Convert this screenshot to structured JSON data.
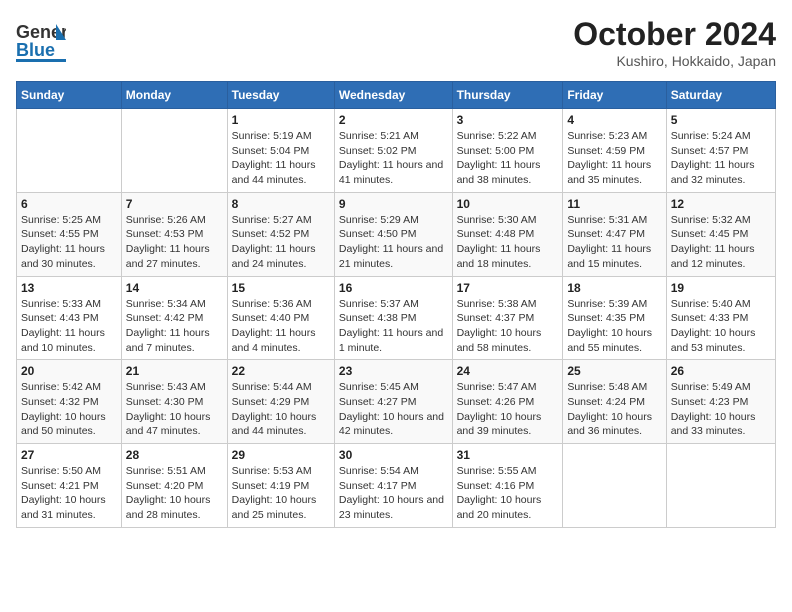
{
  "header": {
    "logo_line1": "General",
    "logo_line2": "Blue",
    "title": "October 2024",
    "subtitle": "Kushiro, Hokkaido, Japan"
  },
  "weekdays": [
    "Sunday",
    "Monday",
    "Tuesday",
    "Wednesday",
    "Thursday",
    "Friday",
    "Saturday"
  ],
  "weeks": [
    [
      {
        "day": "",
        "sunrise": "",
        "sunset": "",
        "daylight": ""
      },
      {
        "day": "",
        "sunrise": "",
        "sunset": "",
        "daylight": ""
      },
      {
        "day": "1",
        "sunrise": "Sunrise: 5:19 AM",
        "sunset": "Sunset: 5:04 PM",
        "daylight": "Daylight: 11 hours and 44 minutes."
      },
      {
        "day": "2",
        "sunrise": "Sunrise: 5:21 AM",
        "sunset": "Sunset: 5:02 PM",
        "daylight": "Daylight: 11 hours and 41 minutes."
      },
      {
        "day": "3",
        "sunrise": "Sunrise: 5:22 AM",
        "sunset": "Sunset: 5:00 PM",
        "daylight": "Daylight: 11 hours and 38 minutes."
      },
      {
        "day": "4",
        "sunrise": "Sunrise: 5:23 AM",
        "sunset": "Sunset: 4:59 PM",
        "daylight": "Daylight: 11 hours and 35 minutes."
      },
      {
        "day": "5",
        "sunrise": "Sunrise: 5:24 AM",
        "sunset": "Sunset: 4:57 PM",
        "daylight": "Daylight: 11 hours and 32 minutes."
      }
    ],
    [
      {
        "day": "6",
        "sunrise": "Sunrise: 5:25 AM",
        "sunset": "Sunset: 4:55 PM",
        "daylight": "Daylight: 11 hours and 30 minutes."
      },
      {
        "day": "7",
        "sunrise": "Sunrise: 5:26 AM",
        "sunset": "Sunset: 4:53 PM",
        "daylight": "Daylight: 11 hours and 27 minutes."
      },
      {
        "day": "8",
        "sunrise": "Sunrise: 5:27 AM",
        "sunset": "Sunset: 4:52 PM",
        "daylight": "Daylight: 11 hours and 24 minutes."
      },
      {
        "day": "9",
        "sunrise": "Sunrise: 5:29 AM",
        "sunset": "Sunset: 4:50 PM",
        "daylight": "Daylight: 11 hours and 21 minutes."
      },
      {
        "day": "10",
        "sunrise": "Sunrise: 5:30 AM",
        "sunset": "Sunset: 4:48 PM",
        "daylight": "Daylight: 11 hours and 18 minutes."
      },
      {
        "day": "11",
        "sunrise": "Sunrise: 5:31 AM",
        "sunset": "Sunset: 4:47 PM",
        "daylight": "Daylight: 11 hours and 15 minutes."
      },
      {
        "day": "12",
        "sunrise": "Sunrise: 5:32 AM",
        "sunset": "Sunset: 4:45 PM",
        "daylight": "Daylight: 11 hours and 12 minutes."
      }
    ],
    [
      {
        "day": "13",
        "sunrise": "Sunrise: 5:33 AM",
        "sunset": "Sunset: 4:43 PM",
        "daylight": "Daylight: 11 hours and 10 minutes."
      },
      {
        "day": "14",
        "sunrise": "Sunrise: 5:34 AM",
        "sunset": "Sunset: 4:42 PM",
        "daylight": "Daylight: 11 hours and 7 minutes."
      },
      {
        "day": "15",
        "sunrise": "Sunrise: 5:36 AM",
        "sunset": "Sunset: 4:40 PM",
        "daylight": "Daylight: 11 hours and 4 minutes."
      },
      {
        "day": "16",
        "sunrise": "Sunrise: 5:37 AM",
        "sunset": "Sunset: 4:38 PM",
        "daylight": "Daylight: 11 hours and 1 minute."
      },
      {
        "day": "17",
        "sunrise": "Sunrise: 5:38 AM",
        "sunset": "Sunset: 4:37 PM",
        "daylight": "Daylight: 10 hours and 58 minutes."
      },
      {
        "day": "18",
        "sunrise": "Sunrise: 5:39 AM",
        "sunset": "Sunset: 4:35 PM",
        "daylight": "Daylight: 10 hours and 55 minutes."
      },
      {
        "day": "19",
        "sunrise": "Sunrise: 5:40 AM",
        "sunset": "Sunset: 4:33 PM",
        "daylight": "Daylight: 10 hours and 53 minutes."
      }
    ],
    [
      {
        "day": "20",
        "sunrise": "Sunrise: 5:42 AM",
        "sunset": "Sunset: 4:32 PM",
        "daylight": "Daylight: 10 hours and 50 minutes."
      },
      {
        "day": "21",
        "sunrise": "Sunrise: 5:43 AM",
        "sunset": "Sunset: 4:30 PM",
        "daylight": "Daylight: 10 hours and 47 minutes."
      },
      {
        "day": "22",
        "sunrise": "Sunrise: 5:44 AM",
        "sunset": "Sunset: 4:29 PM",
        "daylight": "Daylight: 10 hours and 44 minutes."
      },
      {
        "day": "23",
        "sunrise": "Sunrise: 5:45 AM",
        "sunset": "Sunset: 4:27 PM",
        "daylight": "Daylight: 10 hours and 42 minutes."
      },
      {
        "day": "24",
        "sunrise": "Sunrise: 5:47 AM",
        "sunset": "Sunset: 4:26 PM",
        "daylight": "Daylight: 10 hours and 39 minutes."
      },
      {
        "day": "25",
        "sunrise": "Sunrise: 5:48 AM",
        "sunset": "Sunset: 4:24 PM",
        "daylight": "Daylight: 10 hours and 36 minutes."
      },
      {
        "day": "26",
        "sunrise": "Sunrise: 5:49 AM",
        "sunset": "Sunset: 4:23 PM",
        "daylight": "Daylight: 10 hours and 33 minutes."
      }
    ],
    [
      {
        "day": "27",
        "sunrise": "Sunrise: 5:50 AM",
        "sunset": "Sunset: 4:21 PM",
        "daylight": "Daylight: 10 hours and 31 minutes."
      },
      {
        "day": "28",
        "sunrise": "Sunrise: 5:51 AM",
        "sunset": "Sunset: 4:20 PM",
        "daylight": "Daylight: 10 hours and 28 minutes."
      },
      {
        "day": "29",
        "sunrise": "Sunrise: 5:53 AM",
        "sunset": "Sunset: 4:19 PM",
        "daylight": "Daylight: 10 hours and 25 minutes."
      },
      {
        "day": "30",
        "sunrise": "Sunrise: 5:54 AM",
        "sunset": "Sunset: 4:17 PM",
        "daylight": "Daylight: 10 hours and 23 minutes."
      },
      {
        "day": "31",
        "sunrise": "Sunrise: 5:55 AM",
        "sunset": "Sunset: 4:16 PM",
        "daylight": "Daylight: 10 hours and 20 minutes."
      },
      {
        "day": "",
        "sunrise": "",
        "sunset": "",
        "daylight": ""
      },
      {
        "day": "",
        "sunrise": "",
        "sunset": "",
        "daylight": ""
      }
    ]
  ]
}
